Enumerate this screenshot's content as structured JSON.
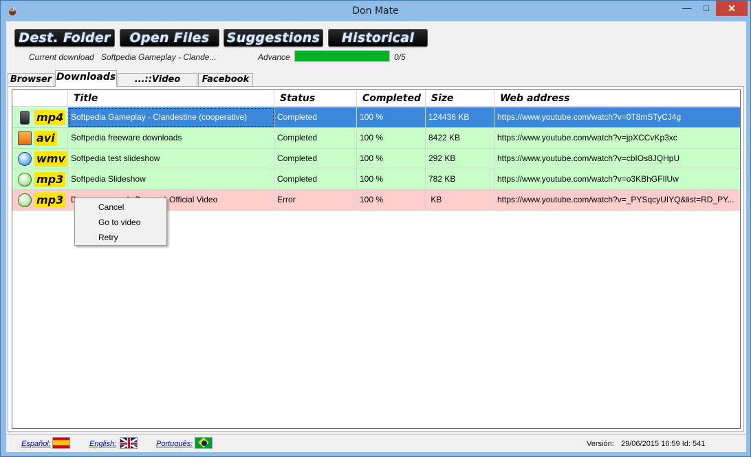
{
  "window": {
    "title": "Don Mate",
    "minimize": "—",
    "maximize": "□",
    "close": "✕"
  },
  "toolbar": {
    "dest_folder": "Dest. Folder",
    "open_files": "Open Files",
    "suggestions": "Suggestions",
    "historical": "Historical"
  },
  "status": {
    "current_label": "Current download",
    "current_value": "Softpedia Gameplay - Clande...",
    "advance_label": "Advance",
    "progress_fraction": 1.0,
    "progress_text": "0/5"
  },
  "tabs": [
    "Browser",
    "Downloads",
    "...::Video Club::...",
    "Facebook"
  ],
  "grid": {
    "columns": [
      "",
      "Title",
      "Status",
      "Completed",
      "Size",
      "Web address"
    ],
    "rows": [
      {
        "ext": "mp4",
        "icon": "phone-icon",
        "title": "Softpedia Gameplay - Clandestine (cooperative)",
        "status": "Completed",
        "completed": "100 %",
        "size": "124436 KB",
        "url": "https://www.youtube.com/watch?v=0T8mSTyCJ4g",
        "state": "selected"
      },
      {
        "ext": "avi",
        "icon": "film-icon",
        "title": "Softpedia freeware downloads",
        "status": "Completed",
        "completed": "100 %",
        "size": "8422 KB",
        "url": "https://www.youtube.com/watch?v=jpXCCvKp3xc",
        "state": "green"
      },
      {
        "ext": "wmv",
        "icon": "media-player-icon",
        "title": "Softpedia test slideshow",
        "status": "Completed",
        "completed": "100 %",
        "size": "292 KB",
        "url": "https://www.youtube.com/watch?v=cbIOs8JQHpU",
        "state": "green"
      },
      {
        "ext": "mp3",
        "icon": "music-note-icon",
        "title": "Softpedia Slideshow",
        "status": "Completed",
        "completed": "100 %",
        "size": "782 KB",
        "url": "https://www.youtube.com/watch?v=o3KBhGFIlUw",
        "state": "green"
      },
      {
        "ext": "mp3",
        "icon": "music-note-icon",
        "title": "D                    a's Dreams) Official Video",
        "status": "Error",
        "completed": "100 %",
        "size": " KB",
        "url": "https://www.youtube.com/watch?v=_PYSqcyUIYQ&list=RD_PY...",
        "state": "red"
      }
    ]
  },
  "context_menu": [
    "Cancel",
    "Go to video",
    "Retry"
  ],
  "footer": {
    "spanish": "Español:",
    "english": "English:",
    "portuguese": "Português:",
    "version_label": "Versión:",
    "version_value": "29/06/2015 16:59 Id: 541"
  },
  "colors": {
    "row_green": "#c8ffc8",
    "row_red": "#ffcccc",
    "selection": "#3b87d9",
    "progress": "#06b025",
    "window_frame": "#8fbce8"
  }
}
